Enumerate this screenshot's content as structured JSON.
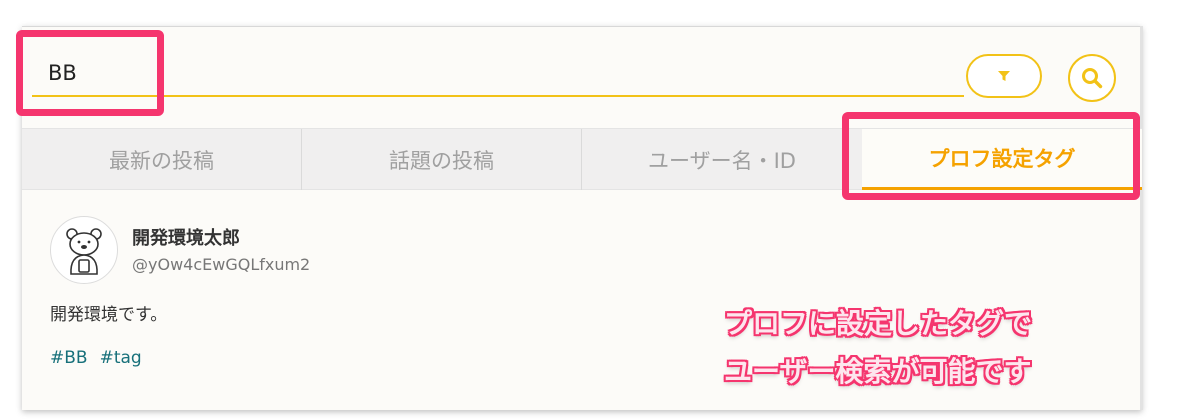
{
  "search": {
    "value": "BB"
  },
  "icons": {
    "filter": "filter-icon",
    "search": "search-icon",
    "avatar": "bear-avatar-icon"
  },
  "tabs": [
    {
      "label": "最新の投稿",
      "active": false
    },
    {
      "label": "話題の投稿",
      "active": false
    },
    {
      "label": "ユーザー名・ID",
      "active": false
    },
    {
      "label": "プロフ設定タグ",
      "active": true
    }
  ],
  "result": {
    "name": "開発環境太郎",
    "handle": "@yOw4cEwGQLfxum2",
    "bio": "開発環境です。",
    "tags": [
      "#BB",
      "#tag"
    ]
  },
  "annotation": {
    "line1": "プロフに設定したタグで",
    "line2": "ユーザー検索が可能です"
  },
  "colors": {
    "accent": "#f2c217",
    "active_tab": "#f5a200",
    "highlight": "#f5356e",
    "tag": "#17707a"
  }
}
